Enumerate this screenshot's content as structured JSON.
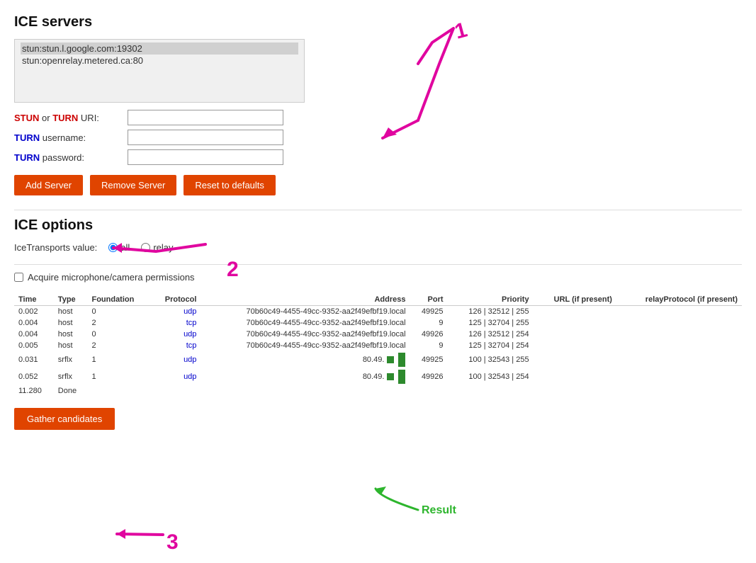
{
  "page": {
    "title": "ICE servers",
    "ice_options_title": "ICE options"
  },
  "server_list": {
    "lines": [
      {
        "text": "stun:stun.l.google.com:19302",
        "selected": true
      },
      {
        "text": "stun:openrelay.metered.ca:80",
        "selected": false
      }
    ]
  },
  "form": {
    "stun_turn_uri_label": "STUN or TURN URI:",
    "stun_label_highlight": "STUN",
    "turn_label1_highlight": "TURN",
    "turn_username_label": "username:",
    "turn_password_label": "password:",
    "turn_label2_highlight": "TURN",
    "turn_label3_highlight": "TURN",
    "stun_turn_uri_value": "",
    "turn_username_value": "",
    "turn_password_value": ""
  },
  "buttons": {
    "add_server": "Add Server",
    "remove_server": "Remove Server",
    "reset_defaults": "Reset to defaults"
  },
  "ice_options": {
    "label": "IceTransports value:",
    "options": [
      {
        "value": "all",
        "label": "all",
        "checked": true
      },
      {
        "value": "relay",
        "label": "relay",
        "checked": false
      }
    ]
  },
  "permissions": {
    "label": "Acquire microphone/camera permissions",
    "checked": false
  },
  "table": {
    "headers": [
      "Time",
      "Type",
      "Foundation",
      "Protocol",
      "Address",
      "Port",
      "Priority",
      "URL (if present)",
      "relayProtocol (if present)"
    ],
    "rows": [
      {
        "time": "0.002",
        "type": "host",
        "foundation": "0",
        "protocol": "udp",
        "address": "70b60c49-4455-49cc-9352-aa2f49efbf19.local",
        "port": "49925",
        "priority": "126 | 32512 | 255",
        "url": "",
        "relay_protocol": "",
        "bar": false
      },
      {
        "time": "0.004",
        "type": "host",
        "foundation": "2",
        "protocol": "tcp",
        "address": "70b60c49-4455-49cc-9352-aa2f49efbf19.local",
        "port": "9",
        "priority": "125 | 32704 | 255",
        "url": "",
        "relay_protocol": "",
        "bar": false
      },
      {
        "time": "0.004",
        "type": "host",
        "foundation": "0",
        "protocol": "udp",
        "address": "70b60c49-4455-49cc-9352-aa2f49efbf19.local",
        "port": "49926",
        "priority": "126 | 32512 | 254",
        "url": "",
        "relay_protocol": "",
        "bar": false
      },
      {
        "time": "0.005",
        "type": "host",
        "foundation": "2",
        "protocol": "tcp",
        "address": "70b60c49-4455-49cc-9352-aa2f49efbf19.local",
        "port": "9",
        "priority": "125 | 32704 | 254",
        "url": "",
        "relay_protocol": "",
        "bar": false
      },
      {
        "time": "0.031",
        "type": "srflx",
        "foundation": "1",
        "protocol": "udp",
        "address": "80.49.",
        "port": "49925",
        "priority": "100 | 32543 | 255",
        "url": "",
        "relay_protocol": "",
        "bar": true
      },
      {
        "time": "0.052",
        "type": "srflx",
        "foundation": "1",
        "protocol": "udp",
        "address": "80.49.",
        "port": "49926",
        "priority": "100 | 32543 | 254",
        "url": "",
        "relay_protocol": "",
        "bar": true
      },
      {
        "time": "11.280",
        "type": "Done",
        "foundation": "",
        "protocol": "",
        "address": "",
        "port": "",
        "priority": "",
        "url": "",
        "relay_protocol": "",
        "bar": false,
        "done": true
      }
    ]
  },
  "gather_button": "Gather candidates",
  "annotation_result_label": "Result"
}
